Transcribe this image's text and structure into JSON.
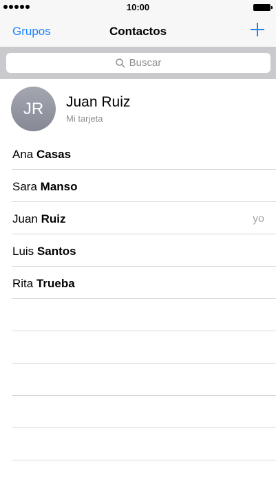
{
  "status_bar": {
    "time": "10:00"
  },
  "nav": {
    "left_label": "Grupos",
    "title": "Contactos",
    "add_icon": "plus-icon",
    "accent": "#1a82fb"
  },
  "search": {
    "placeholder": "Buscar"
  },
  "my_card": {
    "initials": "JR",
    "name": "Juan Ruiz",
    "subtitle": "Mi tarjeta"
  },
  "contacts": [
    {
      "first": "Ana",
      "last": "Casas",
      "tag": ""
    },
    {
      "first": "Sara",
      "last": "Manso",
      "tag": ""
    },
    {
      "first": "Juan",
      "last": "Ruiz",
      "tag": "yo"
    },
    {
      "first": "Luis",
      "last": "Santos",
      "tag": ""
    },
    {
      "first": "Rita",
      "last": "Trueba",
      "tag": ""
    }
  ]
}
